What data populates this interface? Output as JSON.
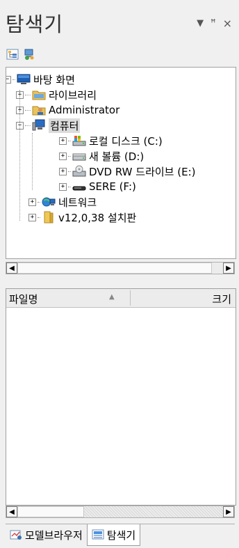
{
  "panel": {
    "title": "탐색기",
    "dropdown_glyph": "▼",
    "pin_glyph": "ꟸ",
    "close_glyph": "×"
  },
  "toolbar": {
    "icons": [
      "tree-view-icon",
      "network-view-icon"
    ]
  },
  "tree": {
    "items": [
      {
        "label": "바탕 화면",
        "expander": "−",
        "icon": "desktop-icon"
      },
      {
        "label": "라이브러리",
        "expander": "+",
        "icon": "libraries-folder-icon"
      },
      {
        "label": "Administrator",
        "expander": "+",
        "icon": "user-folder-icon"
      },
      {
        "label": "컴퓨터",
        "expander": "−",
        "icon": "computer-icon",
        "selected": true
      },
      {
        "label": "로컬 디스크 (C:)",
        "expander": "+",
        "icon": "local-disk-icon"
      },
      {
        "label": "새 볼륨 (D:)",
        "expander": "+",
        "icon": "hard-drive-icon"
      },
      {
        "label": "DVD RW 드라이브 (E:)",
        "expander": "+",
        "icon": "dvd-drive-icon"
      },
      {
        "label": "SERE (F:)",
        "expander": "+",
        "icon": "removable-drive-icon"
      },
      {
        "label": "네트워크",
        "expander": "+",
        "icon": "network-icon"
      },
      {
        "label": "v12,0,38 설치판",
        "expander": "+",
        "icon": "folder-icon"
      }
    ]
  },
  "file_list": {
    "columns": {
      "name": "파일명",
      "size": "크기"
    },
    "sort_glyph": "▲"
  },
  "scroll": {
    "left_glyph": "◀",
    "right_glyph": "▶"
  },
  "tabs": [
    {
      "label": "모델브라우저",
      "icon": "model-browser-icon",
      "active": false
    },
    {
      "label": "탐색기",
      "icon": "explorer-icon",
      "active": true
    }
  ]
}
